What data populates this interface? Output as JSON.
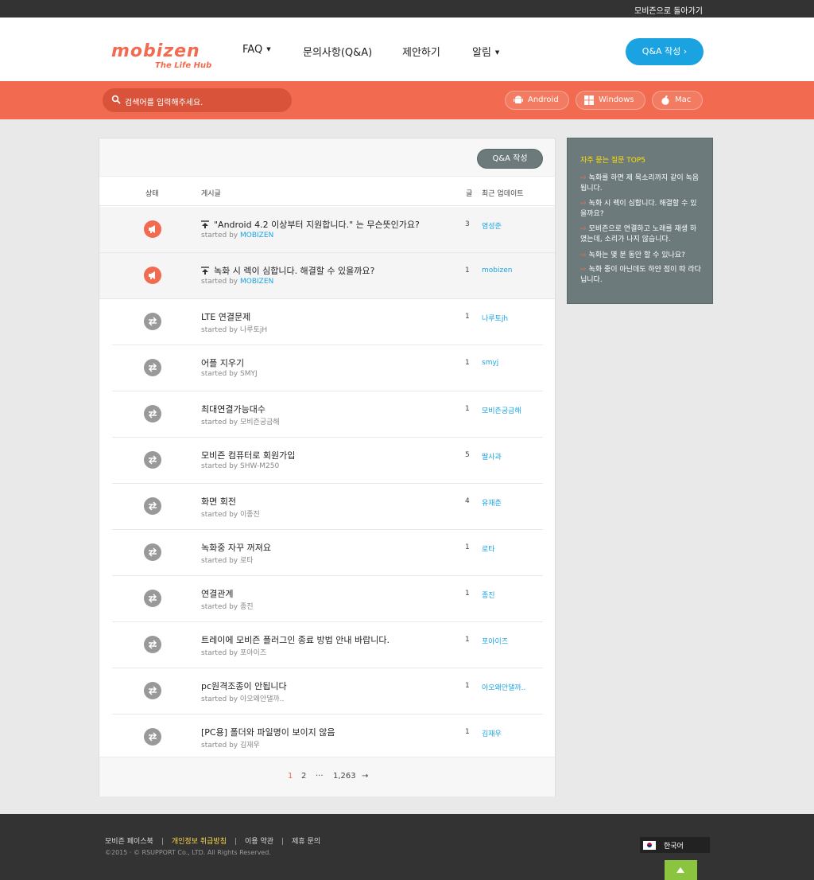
{
  "topbar": {
    "back_link": "모비즌으로 돌아가기"
  },
  "header": {
    "logo_text": "mobizen",
    "logo_tagline": "The Life Hub",
    "nav": [
      {
        "label": "FAQ",
        "has_caret": true
      },
      {
        "label": "문의사항(Q&A)",
        "has_caret": false
      },
      {
        "label": "제안하기",
        "has_caret": false
      },
      {
        "label": "알림",
        "has_caret": true
      }
    ],
    "qa_button": "Q&A 작성 ›"
  },
  "search": {
    "placeholder": "검색어를 입력해주세요.",
    "platforms": [
      "Android",
      "Windows",
      "Mac"
    ]
  },
  "board": {
    "write_button": "Q&A 작성",
    "columns": {
      "status": "상태",
      "post": "게시글",
      "count": "글",
      "last": "최근 업데이트"
    },
    "started_prefix": "started by",
    "rows": [
      {
        "title": "\"Android 4.2 이상부터 지원합니다.\" 는 무슨뜻인가요?",
        "author": "MOBIZEN",
        "count": "3",
        "last": "염성준",
        "sticky": true
      },
      {
        "title": "녹화 시 렉이 심합니다. 해결할 수 있을까요?",
        "author": "MOBIZEN",
        "count": "1",
        "last": "mobizen",
        "sticky": true
      },
      {
        "title": "LTE 연결문제",
        "author": "나루토jH",
        "count": "1",
        "last": "나루토jh",
        "sticky": false
      },
      {
        "title": "어플 지우기",
        "author": "SMYJ",
        "count": "1",
        "last": "smyj",
        "sticky": false
      },
      {
        "title": "최대연결가능대수",
        "author": "모비즌궁금해",
        "count": "1",
        "last": "모비즌궁금해",
        "sticky": false
      },
      {
        "title": "모비즌 컴퓨터로 회원가입",
        "author": "SHW-M250",
        "count": "5",
        "last": "딸사과",
        "sticky": false
      },
      {
        "title": "화면 회전",
        "author": "이종진",
        "count": "4",
        "last": "유재춘",
        "sticky": false
      },
      {
        "title": "녹화중 자꾸 꺼져요",
        "author": "로타",
        "count": "1",
        "last": "로타",
        "sticky": false
      },
      {
        "title": "연결관계",
        "author": "종진",
        "count": "1",
        "last": "종진",
        "sticky": false
      },
      {
        "title": "트레이에 모비즌 플러그인 종료 방법 안내 바랍니다.",
        "author": "포아이즈",
        "count": "1",
        "last": "포아이즈",
        "sticky": false
      },
      {
        "title": "pc원격조종이 안됩니다",
        "author": "아오왜안댈까..",
        "count": "1",
        "last": "아오왜안댈까..",
        "sticky": false
      },
      {
        "title": "[PC용] 폴더와 파일명이 보이지 않음",
        "author": "김재우",
        "count": "1",
        "last": "김재우",
        "sticky": false
      }
    ],
    "pagination": {
      "current": "1",
      "next": "2",
      "ellipsis": "···",
      "last": "1,263",
      "arrow": "→"
    }
  },
  "sidebar": {
    "title": "자주 묻는 질문 TOP5",
    "items": [
      "녹화를 하면 제 목소리까지 같이 녹음됩니다.",
      "녹화 시 렉이 심합니다. 해결할 수 있을까요?",
      "모비즌으로 연결하고 노래를 재생 하였는데, 소리가 나지 않습니다.",
      "녹화는 몇 분 동안 할 수 있나요?",
      "녹화 중이 아닌데도 하얀 점이 따 라다닙니다."
    ]
  },
  "footer": {
    "links": [
      "모비즌 페이스북",
      "개인정보 취급방침",
      "이용 약관",
      "제휴 문의"
    ],
    "copyright": "©2015 · © RSUPPORT Co., LTD. All Rights Reserved.",
    "language": "한국어"
  },
  "colors": {
    "brand": "#f26a4f",
    "accent": "#1aa3e0",
    "sidebar": "#6c7a7c",
    "highlight": "#ffe200"
  }
}
